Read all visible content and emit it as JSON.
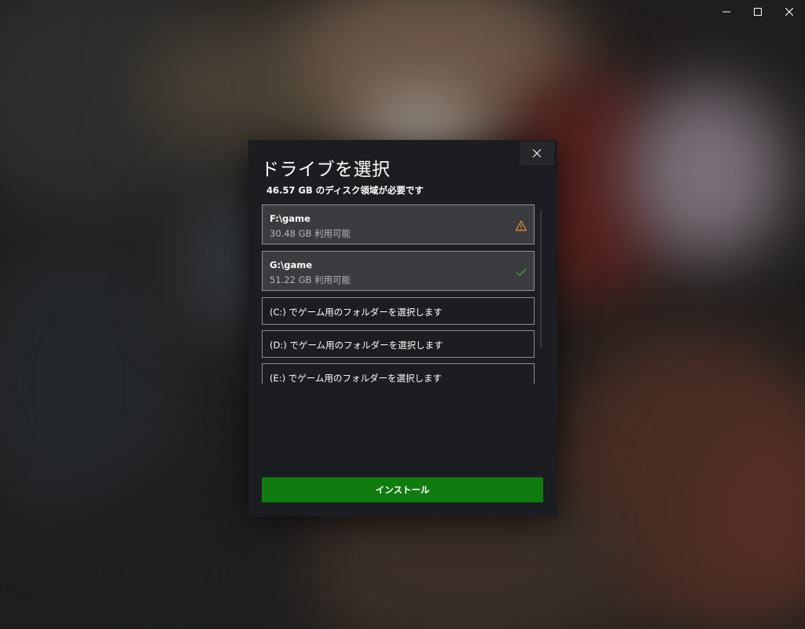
{
  "window": {
    "controls": [
      "minimize-icon",
      "maximize-icon",
      "close-icon"
    ]
  },
  "dialog": {
    "title": "ドライブを選択",
    "required_space": "46.57 GB のディスク領域が必要です",
    "close_icon": "close-icon",
    "drives": [
      {
        "name": "F:\\game",
        "free": "30.48 GB 利用可能",
        "status": "warning-icon",
        "status_color": "#e8912d"
      },
      {
        "name": "G:\\game",
        "free": "51.22 GB 利用可能",
        "status": "check-icon",
        "status_color": "#3f9c35"
      }
    ],
    "folder_options": [
      "(C:) でゲーム用のフォルダーを選択します",
      "(D:) でゲーム用のフォルダーを選択します",
      "(E:) でゲーム用のフォルダーを選択します"
    ],
    "install_label": "インストール",
    "accent_color": "#107c10"
  }
}
